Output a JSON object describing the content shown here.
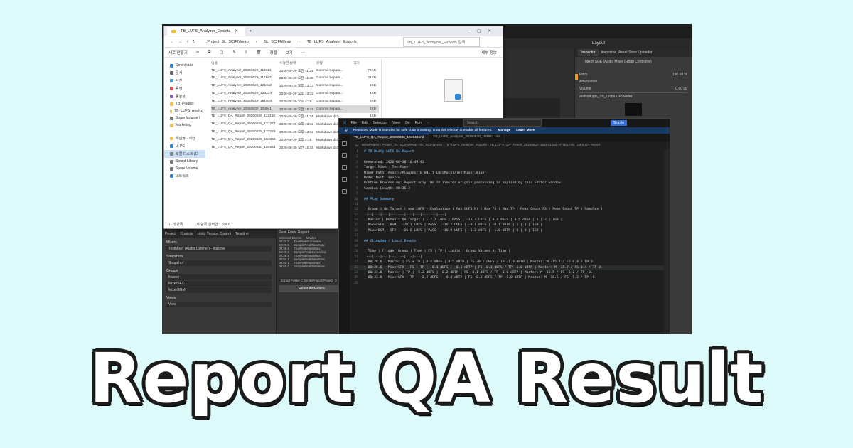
{
  "explorer": {
    "tab_title": "TB_LUFS_Analyzer_Exports",
    "path": [
      "Project_SL_SCIFIWeap",
      "SL_SCIFIWeap",
      "TB_LUFS_Analyzer_Exports"
    ],
    "search_placeholder": "TB_LUFS_Analyzer_Exports 검색",
    "commands": [
      "새로 만들기",
      "정렬",
      "보기"
    ],
    "details": "세부 정보",
    "nav": [
      "Downloads",
      "문서",
      "사진",
      "음악",
      "동영상",
      "TB_Plugins",
      "TB_LUFS_Analyz",
      "Spare Volume (",
      "Marketing",
      "",
      "해빈짱 - 개인",
      "내 PC",
      "로컬 디스크 (C",
      "Sound Library",
      "Spare Volume",
      "네트워크"
    ],
    "columns": [
      "이름",
      "수정한 날짜",
      "유형",
      "크기"
    ],
    "files": [
      {
        "name": "TB_LUFS_Analyzer_20260629_112412",
        "date": "2026-06-29 오전 11:24",
        "type": "Comma Separa...",
        "size": "72KB"
      },
      {
        "name": "TB_LUFS_Analyzer_20260629_114803",
        "date": "2026-06-29 오전 11:48",
        "type": "Comma Separa...",
        "size": "11KB"
      },
      {
        "name": "TB_LUFS_Analyzer_20260629_121342",
        "date": "2026-06-29 오후 12:13",
        "type": "Comma Separa...",
        "size": "1KB"
      },
      {
        "name": "TB_LUFS_Analyzer_20260629_123224",
        "date": "2026-06-29 오후 12:32",
        "type": "Comma Separa...",
        "size": "4KB"
      },
      {
        "name": "TB_LUFS_Analyzer_20260629_161849",
        "date": "2026-06-29 오후 4:18",
        "type": "Comma Separa...",
        "size": "2KB"
      },
      {
        "name": "TB_LUFS_Analyzer_20260630_104941",
        "date": "2026-06-30 오전 10:49",
        "type": "Comma Separa...",
        "size": "2KB"
      },
      {
        "name": "TB_LUFS_QA_Report_20260629_112410",
        "date": "2026-06-29 오전 11:24",
        "type": "Markdown 소스...",
        "size": "1KB"
      },
      {
        "name": "TB_LUFS_QA_Report_20260629_121243",
        "date": "2026-06-29 오후 12:12",
        "type": "Markdown 소스...",
        "size": "1KB"
      },
      {
        "name": "TB_LUFS_QA_Report_20260629_123225",
        "date": "2026-06-29 오후 12:32",
        "type": "Markdown 소스...",
        "size": "1KB"
      },
      {
        "name": "TB_LUFS_QA_Report_20260629_161855",
        "date": "2026-06-29 오후 4:18",
        "type": "Markdown 소스...",
        "size": "1KB"
      },
      {
        "name": "TB_LUFS_QA_Report_20260630_104943",
        "date": "2026-06-30 오전 10:49",
        "type": "Markdown 소스...",
        "size": "2KB"
      }
    ],
    "status": [
      "11개 항목",
      "1개 항목 선택함 1.59KB"
    ]
  },
  "unity": {
    "layout": "Layout",
    "inspector_tabs": [
      "Inspector",
      "Inspector",
      "Asset Store Uploader"
    ],
    "mixer_title": "Mixer SGE (Audio Mixer Group Controller)",
    "pitch_label": "Pitch",
    "pitch_value": "100.00 %",
    "attenuation": "Attenuation",
    "volume_label": "Volume",
    "volume_value": "-0.60 db",
    "plugin": "audioplugin_TB_UnityLUFSMeter",
    "bottom_tabs": [
      "Project",
      "Console",
      "Unity Version Control",
      "Timeline"
    ],
    "mixers_h": "Mixers",
    "mixer_row": "TestMixer  (Audio Listener) - Inactive",
    "snapshots_h": "Snapshots",
    "snapshot_row": "Snapshot",
    "groups_h": "Groups",
    "groups": [
      "Master",
      "MixerSFX",
      "MixerBGM"
    ],
    "views_h": "Views",
    "view_row": "View",
    "peak_h": "Peak Event Report",
    "selected_events": "Selected Events",
    "master": "Master",
    "events": [
      [
        "00:33.8",
        "TruePeakExceeded"
      ],
      [
        "00:29.8",
        "SamplePeakNearMax"
      ],
      [
        "00:39.9",
        "TruePeakNearMax"
      ],
      [
        "00:39.8",
        "SamplePeakExceeded"
      ],
      [
        "00:39.8",
        "TruePeakNearMax"
      ],
      [
        "00:50.1",
        "SamplePeakNearMax"
      ],
      [
        "00:50.1",
        "TruePeakNearMax"
      ],
      [
        "00:55.0",
        "SamplePeakNearMax"
      ]
    ],
    "export_label": "Export Folder",
    "export_path": "C:/UnityProject/Project_S",
    "reset_button": "Reset All Meters"
  },
  "vscode": {
    "menu": [
      "File",
      "Edit",
      "Selection",
      "View",
      "Go",
      "Run"
    ],
    "search": "Search",
    "sign_in": "Sign in",
    "banner": "Restricted Mode is intended for safe code browsing. Trust this window to enable all features.",
    "manage": "Manage",
    "learn_more": "Learn More",
    "tabs": [
      "TB_LUFS_QA_Report_20260630_104943.md",
      "TB_LUFS_Analyzer_20260630_104941.csv"
    ],
    "breadcrumb": "C: › UnityProject › Project_SL_SCIFIWeap › SL_SCIFIWeap › TB_LUFS_Analyzer_Exports › TB_LUFS_QA_Report_20260630_104943.md › # TB Unity LUFS QA Report",
    "lines": [
      "# TB Unity LUFS QA Report",
      "",
      "Generated: 2026-06-30 10:49:43",
      "Target Mixer: TestMixer",
      "Mixer Path: Assets/Plugins/TB_UNITY_LUFSMeter/TestMixer.mixer",
      "Mode: Multi-source",
      "Runtime Processing: Report only. No TP limiter or gain processing is applied by this Editor window.",
      "Session Length: 00:36.3",
      "",
      "## Play Summary",
      "",
      "| Group | QA Target | Avg LUFS | Evaluation | Max LUFS(M) | Max FS | Max TP | Peak Count FS | Peak Count TP | Samples |",
      "|---|---|---|---|---|---|---|---|---|---|",
      "| Master | Default QA Target | -17.7 LUFS | PASS | -13.3 LUFS | 0.4 dBFS | 0.5 dBTP | 1 | 2 | 168 |",
      "| MixerSFX | BGM | -20.1 LUFS | PASS | -16.2 LUFS | -0.1 dBFS | -0.1 dBTP | 1 | 1 | 168 |",
      "| MixerBGM | SFX | -16.6 LUFS | PASS | -16.9 LUFS | -1.2 dBFS | -1.0 dBTP | 0 | 0 | 168 |",
      "",
      "## Clipping / Limit Events",
      "",
      "| Time | Trigger Group | Type | FS | TP | Limits | Group Values At Time |",
      "|---|---|---|---|---|---|---|",
      "| 00:28.6 | Master | FS + TP | 0.4 dBFS | 0.5 dBTP | FS -0.1 dBFS / TP -1.0 dBTP | Master: M -15.7 / FS 0.4 / TP 0.",
      "| 00:28.6 | MixerSFX | FS + TP | -0.1 dBFS | -0.1 dBTP | FS -0.1 dBFS / TP -1.0 dBTP | Master: M -15.7 / FS 0.4 / TP 0.",
      "| 00:33.8 | Master | TP | -5.2 dBFS | -0.2 dBTP | FS -0.1 dBFS / TP -1.0 dBTP | Master: M -16.5 / FS -5.2 / TP -0.",
      "| 00:33.8 | MixerSFX | TP | -2.2 dBFS | -0.4 dBTP | FS -0.1 dBFS / TP -1.0 dBTP | Master: M -16.5 / FS -5.2 / TP -0.",
      ""
    ],
    "line_numbers": [
      "1",
      "2",
      "3",
      "4",
      "5",
      "6",
      "7",
      "8",
      "9",
      "10",
      "11",
      "12",
      "13",
      "14",
      "15",
      "16",
      "17",
      "18",
      "19",
      "20",
      "21",
      "22",
      "23",
      "24",
      "25",
      "26"
    ]
  },
  "headline": "Report QA Result"
}
